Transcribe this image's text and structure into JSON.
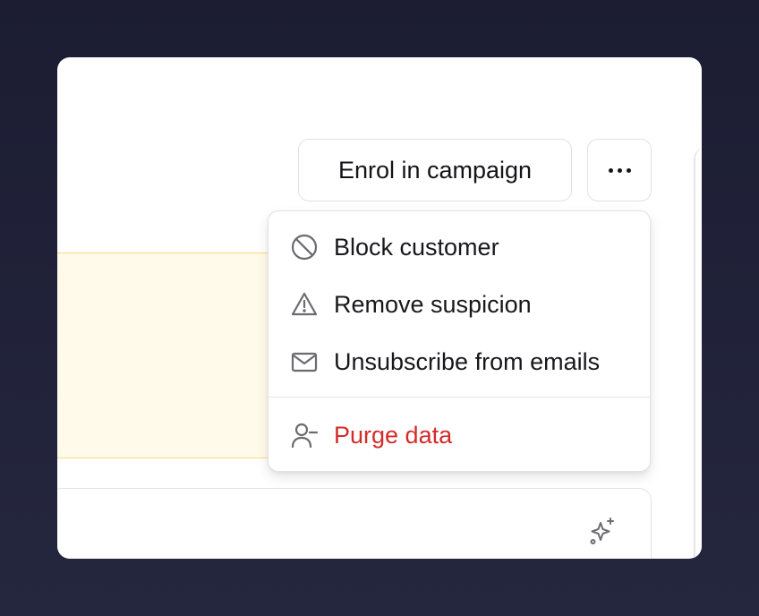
{
  "header": {
    "enrol_label": "Enrol in campaign",
    "more_icon": "more-horizontal-icon"
  },
  "menu": {
    "items": [
      {
        "label": "Block customer",
        "icon": "block-icon"
      },
      {
        "label": "Remove suspicion",
        "icon": "warning-icon"
      },
      {
        "label": "Unsubscribe from emails",
        "icon": "mail-icon"
      }
    ],
    "danger_item": {
      "label": "Purge data",
      "icon": "user-minus-icon",
      "color": "#d52b28"
    }
  },
  "colors": {
    "background": "#1c1d33",
    "banner": "#fffaea",
    "banner_border": "#f7dc7a",
    "danger": "#d52b28"
  },
  "lower_card": {
    "icon": "sparkles-icon"
  }
}
